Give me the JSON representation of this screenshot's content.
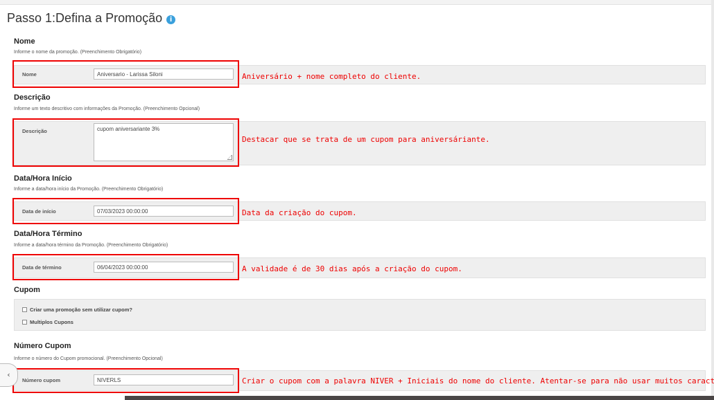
{
  "header": {
    "title": "Passo 1:Defina a Promoção",
    "info_icon": "i"
  },
  "fields": {
    "nome": {
      "heading": "Nome",
      "hint": "Informe o nome da promoção. (Preenchimento Obrigatório)",
      "label": "Nome",
      "value": "Aniversario - Larissa Siloni",
      "note": "Aniversário + nome completo do cliente."
    },
    "descricao": {
      "heading": "Descrição",
      "hint": "Informe um texto descritivo com informações da Promoção. (Preenchimento Opcional)",
      "label": "Descrição",
      "value": "cupom aniversariante 3%",
      "note": "Destacar que se trata de um cupom para aniversáriante."
    },
    "inicio": {
      "heading": "Data/Hora Início",
      "hint": "Informe a data/hora início da Promoção. (Preenchimento Obrigatório)",
      "label": "Data de início",
      "value": "07/03/2023 00:00:00",
      "note": "Data da criação do cupom."
    },
    "termino": {
      "heading": "Data/Hora Término",
      "hint": "Informe a data/hora término da Promoção. (Preenchimento Obrigatório)",
      "label": "Data de término",
      "value": "06/04/2023 00:00:00",
      "note": "A validade é de 30 dias após a criação do cupom."
    },
    "cupom": {
      "heading": "Cupom",
      "option1": "Criar uma promoção sem utilizar cupom?",
      "option2": "Multiplos Cupons"
    },
    "numero": {
      "heading": "Número Cupom",
      "hint": "Informe o número do Cupom promocional. (Preenchimento Opcional)",
      "label": "Número cupom",
      "value": "NIVERLS",
      "note": "Criar o cupom com a palavra NIVER + Iniciais do nome do cliente. Atentar-se para não usar muitos caracteres."
    }
  },
  "sidebar": {
    "collapse_glyph": "‹"
  },
  "colors": {
    "highlight": "#e00000",
    "info": "#3aa0dc",
    "band": "#efefef"
  }
}
